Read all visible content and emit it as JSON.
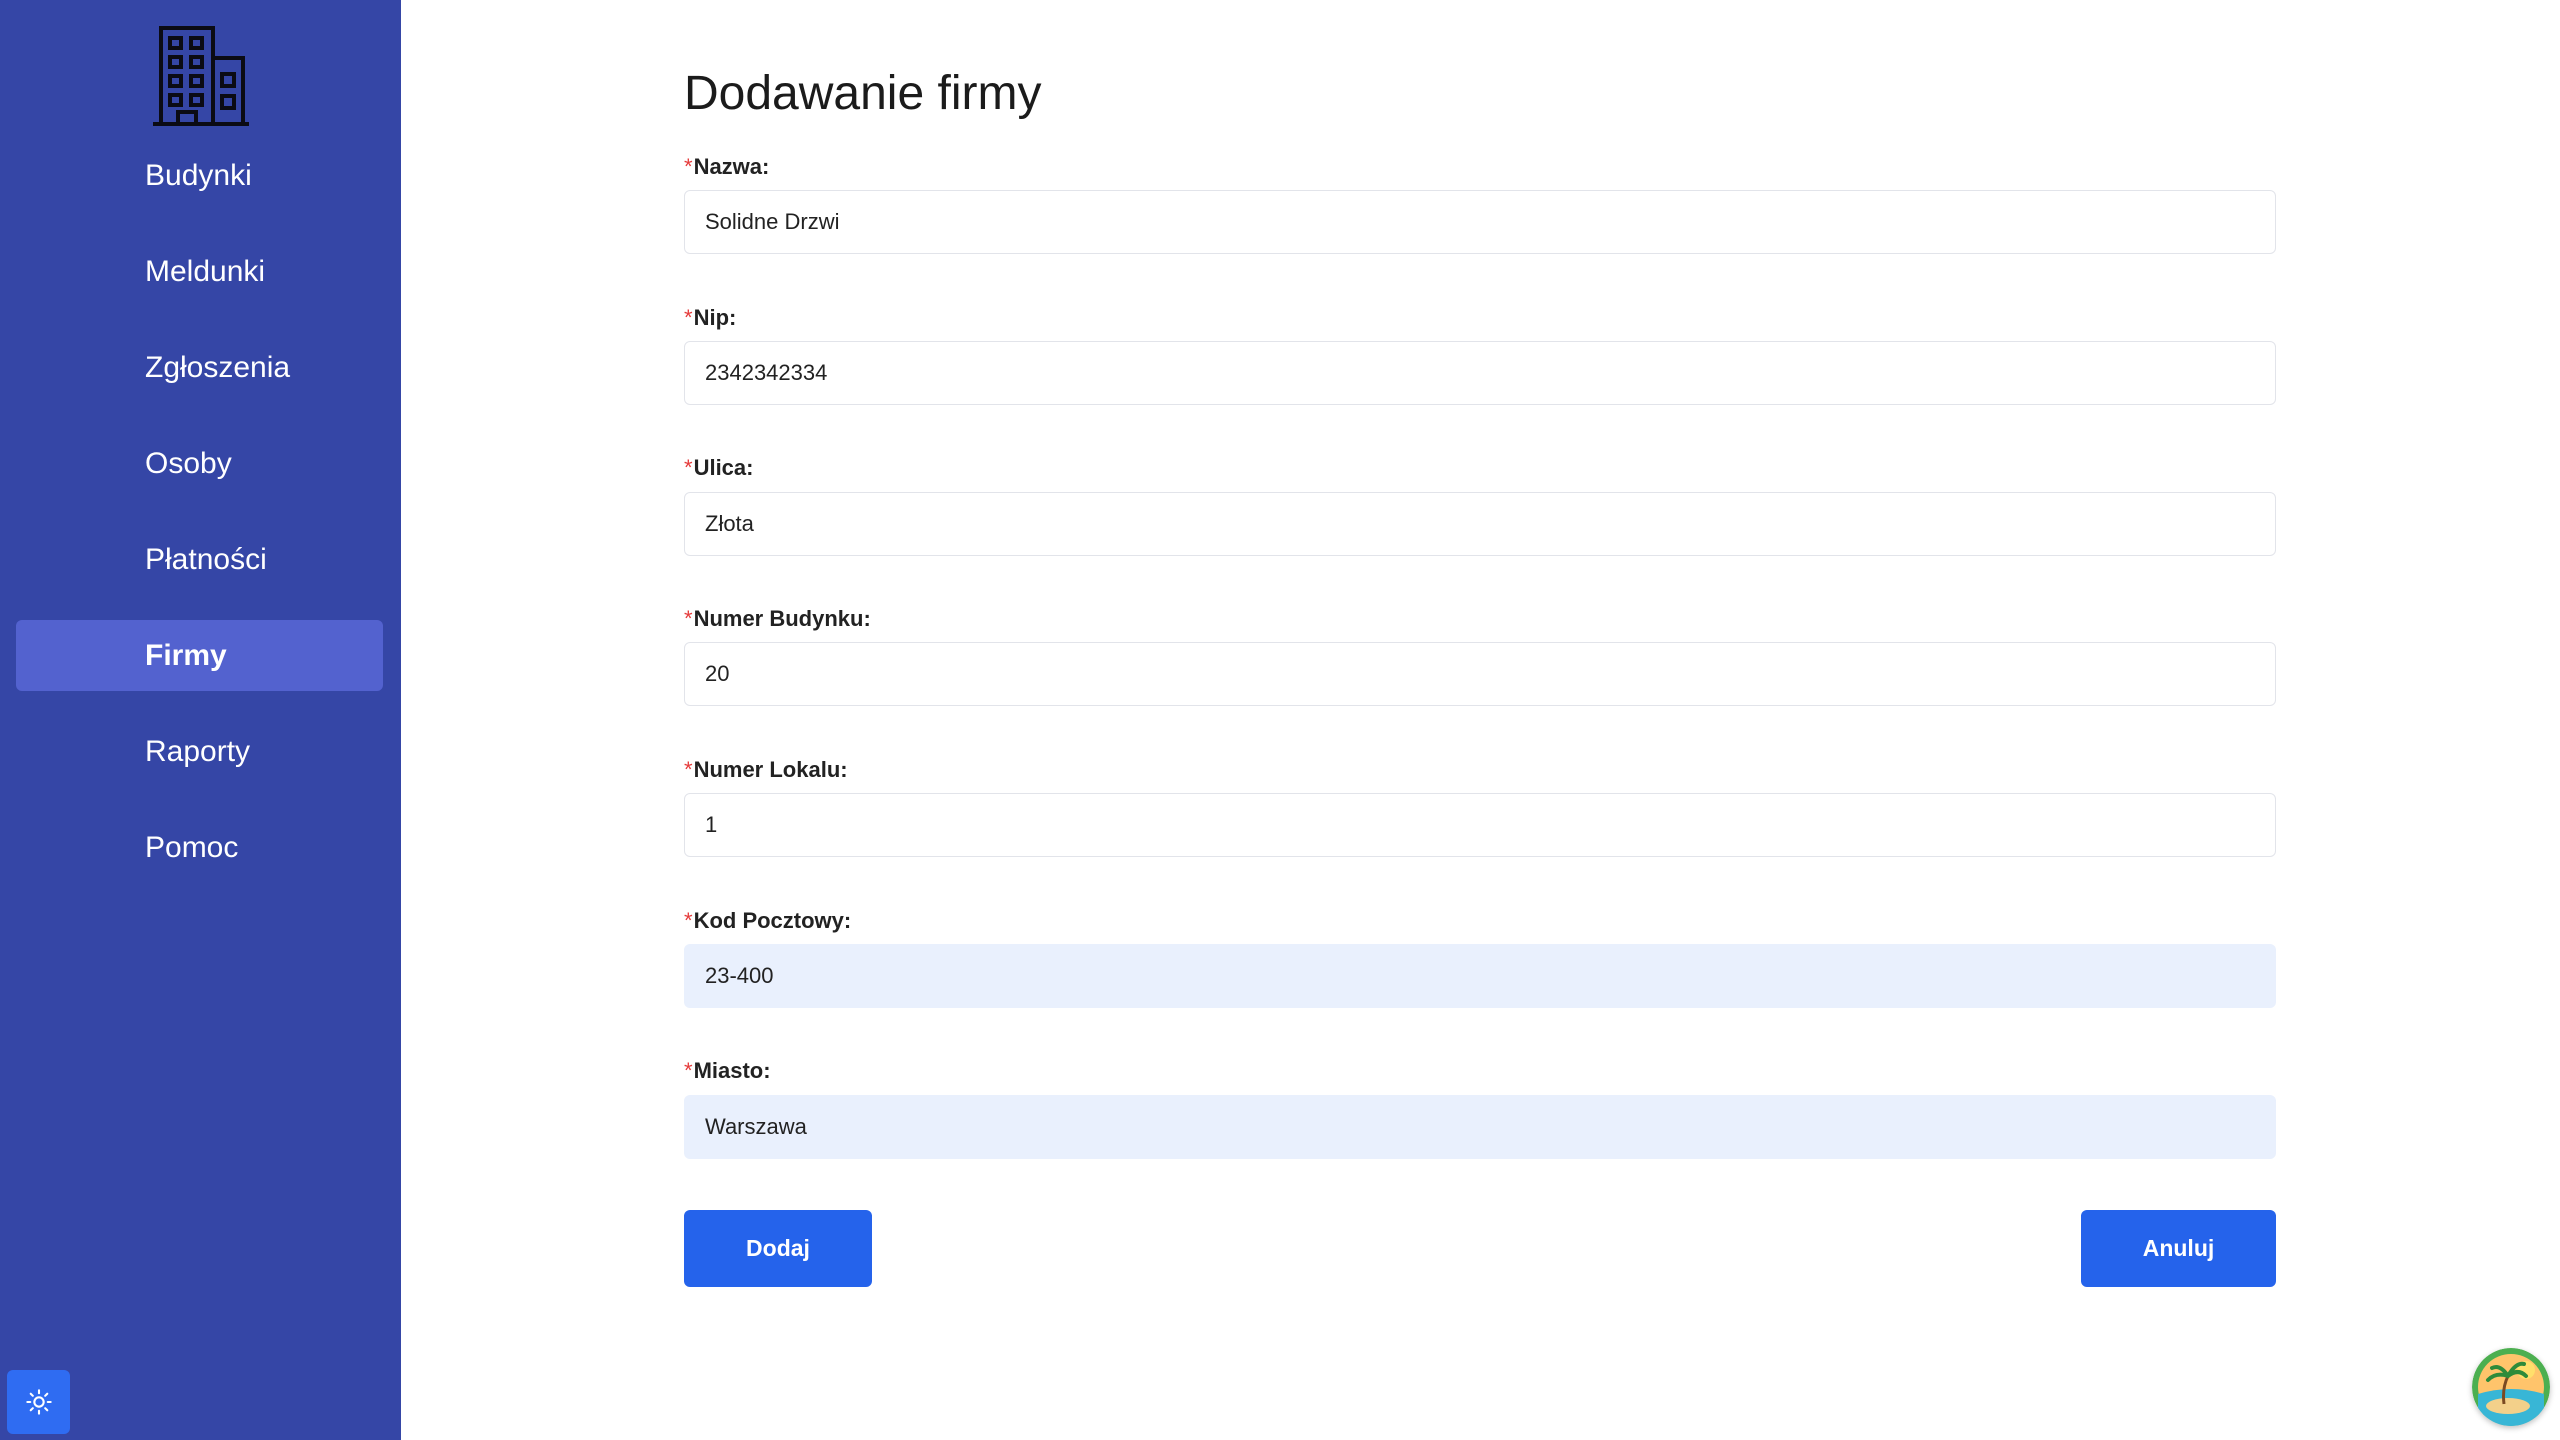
{
  "sidebar": {
    "logo_icon": "building-icon",
    "background": "#3546a6",
    "active_background": "#5362cf",
    "items": [
      {
        "label": "Budynki",
        "active": false
      },
      {
        "label": "Meldunki",
        "active": false
      },
      {
        "label": "Zgłoszenia",
        "active": false
      },
      {
        "label": "Osoby",
        "active": false
      },
      {
        "label": "Płatności",
        "active": false
      },
      {
        "label": "Firmy",
        "active": true
      },
      {
        "label": "Raporty",
        "active": false
      },
      {
        "label": "Pomoc",
        "active": false
      }
    ],
    "theme_toggle_icon": "sun-icon"
  },
  "form": {
    "title": "Dodawanie firmy",
    "required_marker": "*",
    "fields": [
      {
        "label": "Nazwa:",
        "value": "Solidne Drzwi",
        "autofilled": false
      },
      {
        "label": "Nip:",
        "value": "2342342334",
        "autofilled": false
      },
      {
        "label": "Ulica:",
        "value": "Złota",
        "autofilled": false
      },
      {
        "label": "Numer Budynku:",
        "value": "20",
        "autofilled": false
      },
      {
        "label": "Numer Lokalu:",
        "value": "1",
        "autofilled": false
      },
      {
        "label": "Kod Pocztowy:",
        "value": "23-400",
        "autofilled": true
      },
      {
        "label": "Miasto:",
        "value": "Warszawa",
        "autofilled": true
      }
    ],
    "submit_label": "Dodaj",
    "cancel_label": "Anuluj",
    "button_color": "#2563eb"
  },
  "widget": {
    "icon": "island-avatar-icon"
  }
}
